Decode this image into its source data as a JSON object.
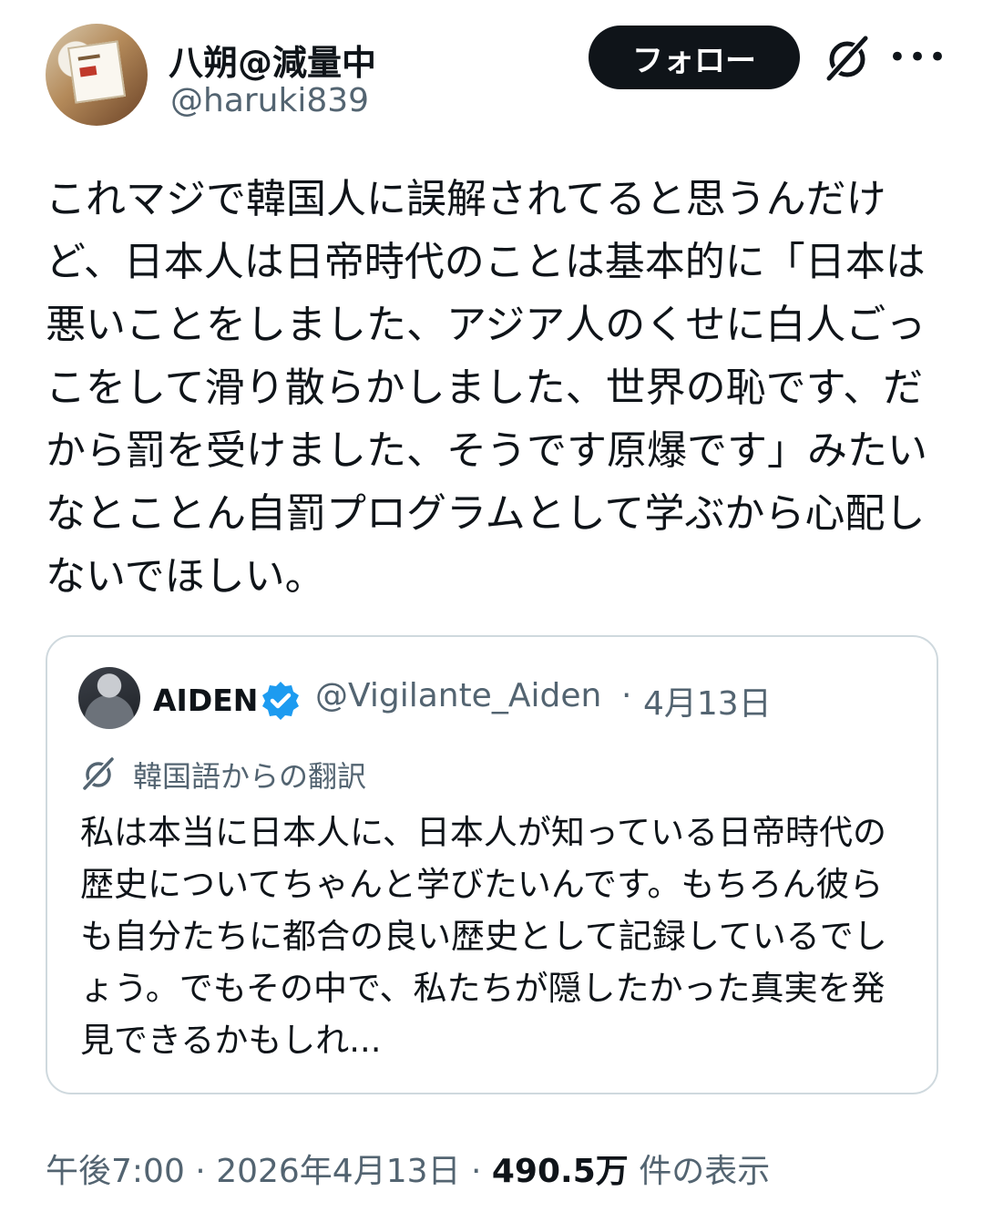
{
  "author": {
    "name": "八朔@減量中",
    "handle": "@haruki839"
  },
  "actions": {
    "follow_label": "フォロー",
    "grok_icon": "grok-slash-icon",
    "more_icon": "more-dots-icon",
    "more_glyph": "•••"
  },
  "tweet": {
    "text": "これマジで韓国人に誤解されてると思うんだけど、日本人は日帝時代のことは基本的に「日本は悪いことをしました、アジア人のくせに白人ごっこをして滑り散らかしました、世界の恥です、だから罰を受けました、そうです原爆です」みたいなとことん自罰プログラムとして学ぶから心配しないでほしい。"
  },
  "quote": {
    "name": "AIDEN",
    "verified": true,
    "handle": "@Vigilante_Aiden",
    "separator": "·",
    "date": "4月13日",
    "translation_label": "韓国語からの翻訳",
    "text": "私は本当に日本人に、日本人が知っている日帝時代の歴史についてちゃんと学びたいんです。もちろん彼らも自分たちに都合の良い歴史として記録しているでしょう。でもその中で、私たちが隠したかった真実を発見できるかもしれ..."
  },
  "meta": {
    "time": "午後7:00",
    "sep1": " · ",
    "date": "2026年4月13日",
    "sep2": " · ",
    "views": "490.5万",
    "views_label": " 件の表示"
  },
  "colors": {
    "text": "#0f1419",
    "secondary": "#536471",
    "border": "#cfd9de",
    "verified": "#1d9bf0",
    "button_bg": "#0f1419"
  }
}
